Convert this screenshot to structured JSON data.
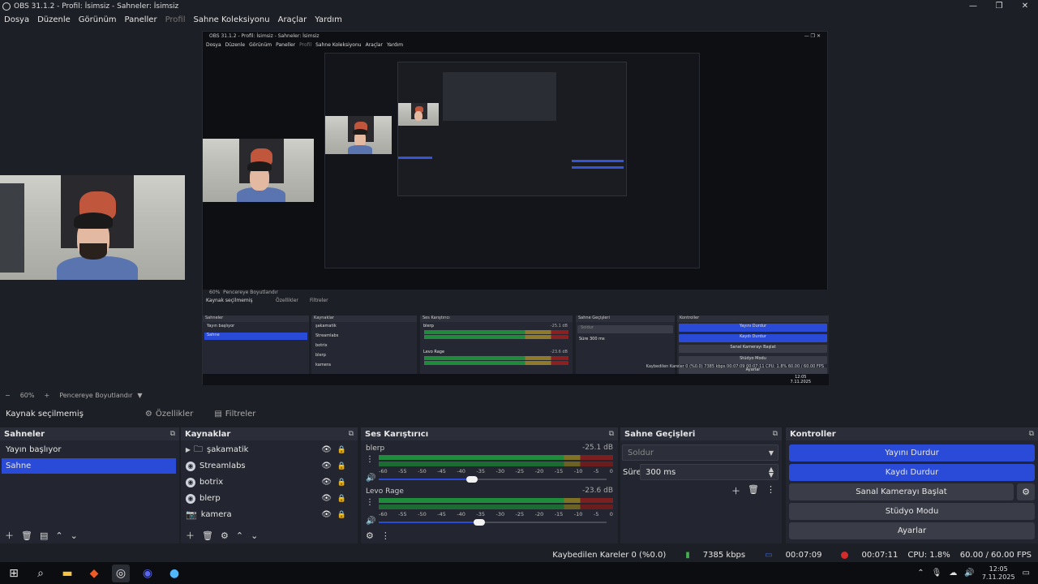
{
  "window": {
    "title": "OBS 31.1.2 - Profil: İsimsiz - Sahneler: İsimsiz",
    "minimize": "—",
    "restore": "❐",
    "close": "✕"
  },
  "menu": [
    "Dosya",
    "Düzenle",
    "Görünüm",
    "Paneller",
    "Profil",
    "Sahne Koleksiyonu",
    "Araçlar",
    "Yardım"
  ],
  "nested": {
    "title": "OBS 31.1.2 - Profil: İsimsiz - Sahneler: İsimsiz",
    "menu": [
      "Dosya",
      "Düzenle",
      "Görünüm",
      "Paneller",
      "Profil",
      "Sahne Koleksiyonu",
      "Araçlar",
      "Yardım"
    ],
    "zoom": "60%",
    "fit": "Pencereye Boyutlandır",
    "no_source": "Kaynak seçilmemiş",
    "props": "Özellikler",
    "filters": "Filtreler",
    "scenes_title": "Sahneler",
    "sources_title": "Kaynaklar",
    "mixer_title": "Ses Karıştırıcı",
    "transitions_title": "Sahne Geçişleri",
    "controls_title": "Kontroller",
    "scenes": [
      "Yayın başlıyor",
      "Sahne"
    ],
    "sources": [
      "şakamatik",
      "Streamlabs",
      "botrix",
      "blerp",
      "kamera"
    ],
    "ch1": "blerp",
    "ch1_db": "-25.1 dB",
    "ch2": "Levo Rage",
    "ch2_db": "-23.6 dB",
    "transition": "Soldur",
    "dur_label": "Süre",
    "dur": "300 ms",
    "btns": [
      "Yayını Durdur",
      "Kaydı Durdur",
      "Sanal Kamerayı Başlat",
      "Stüdyo Modu",
      "Ayarlar"
    ],
    "status": "Kaybedilen Kareler 0 (%0.0)   7385 kbps   00:07:09   00:07:11   CPU: 1.8%   60.00 / 60.00 FPS",
    "clock_time": "12:05",
    "clock_date": "7.11.2025"
  },
  "scene_toolbar": {
    "minus": "−",
    "zoom": "60%",
    "plus": "+",
    "fit": "Pencereye Boyutlandır",
    "caret": "▼"
  },
  "propbar": {
    "no_source": "Kaynak seçilmemiş",
    "properties": "Özellikler",
    "filters": "Filtreler"
  },
  "scenes": {
    "title": "Sahneler",
    "items": [
      "Yayın başlıyor",
      "Sahne"
    ],
    "selected": 1
  },
  "sources": {
    "title": "Kaynaklar",
    "items": [
      {
        "name": "şakamatik",
        "icon": "folder-icon"
      },
      {
        "name": "Streamlabs",
        "icon": "browser-icon"
      },
      {
        "name": "botrix",
        "icon": "browser-icon"
      },
      {
        "name": "blerp",
        "icon": "browser-icon"
      },
      {
        "name": "kamera",
        "icon": "camera-icon"
      }
    ]
  },
  "mixer": {
    "title": "Ses Karıştırıcı",
    "ticks": [
      "-60",
      "-55",
      "-50",
      "-45",
      "-40",
      "-35",
      "-30",
      "-25",
      "-20",
      "-15",
      "-10",
      "-5",
      "0"
    ],
    "channels": [
      {
        "name": "blerp",
        "db": "-25.1 dB",
        "volume": 0.41
      },
      {
        "name": "Levo Rage",
        "db": "-23.6 dB",
        "volume": 0.44
      }
    ]
  },
  "transitions": {
    "title": "Sahne Geçişleri",
    "selected": "Soldur",
    "duration_label": "Süre",
    "duration": "300 ms"
  },
  "controls": {
    "title": "Kontroller",
    "stop_stream": "Yayını Durdur",
    "stop_record": "Kaydı Durdur",
    "virtual_cam": "Sanal Kamerayı Başlat",
    "studio_mode": "Stüdyo Modu",
    "settings": "Ayarlar"
  },
  "status": {
    "dropped": "Kaybedilen Kareler 0 (%0.0)",
    "bitrate": "7385 kbps",
    "stream_time": "00:07:09",
    "rec_time": "00:07:11",
    "cpu": "CPU: 1.8%",
    "fps": "60.00 / 60.00 FPS"
  },
  "taskbar": {
    "time": "12:05",
    "date": "7.11.2025"
  },
  "colors": {
    "accent": "#2a4bd7",
    "bg": "#1d1f26",
    "dock": "#232630",
    "rec": "#d52b2b"
  }
}
